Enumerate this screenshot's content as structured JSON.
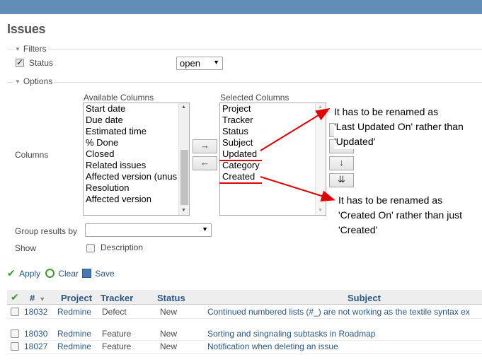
{
  "page": {
    "title": "Issues"
  },
  "filters": {
    "legend": "Filters",
    "status_label": "Status",
    "status_checked": true,
    "status_value": "open"
  },
  "options": {
    "legend": "Options",
    "columns_label": "Columns",
    "available_title": "Available Columns",
    "available_items": [
      "Start date",
      "Due date",
      "Estimated time",
      "% Done",
      "Closed",
      "Related issues",
      "Affected version (unus",
      "Resolution",
      "Affected version"
    ],
    "selected_title": "Selected Columns",
    "selected_items": [
      "Project",
      "Tracker",
      "Status",
      "Subject",
      "Updated",
      "Category",
      "Created"
    ],
    "move_right": "→",
    "move_left": "←",
    "move_top": "⇈",
    "move_up": "↑",
    "move_down": "↓",
    "move_bottom": "⇊",
    "group_label": "Group results by",
    "group_value": "",
    "show_label": "Show",
    "description_label": "Description",
    "description_checked": false
  },
  "actions": {
    "apply": "Apply",
    "clear": "Clear",
    "save": "Save"
  },
  "annotations": {
    "updated_note": [
      "It has to be renamed as",
      "'Last Updated On' rather than",
      "'Updated'"
    ],
    "created_note": [
      "It has to be renamed as",
      "'Created On' rather than just",
      "'Created'"
    ],
    "color": "#e00000"
  },
  "table": {
    "headers": {
      "id": "#",
      "project": "Project",
      "tracker": "Tracker",
      "status": "Status",
      "subject": "Subject"
    },
    "rows": [
      {
        "id": "18032",
        "project": "Redmine",
        "tracker": "Defect",
        "status": "New",
        "subject": "Continued numbered lists (#_) are not working as the textile syntax ex"
      },
      {
        "id": "18030",
        "project": "Redmine",
        "tracker": "Feature",
        "status": "New",
        "subject": "Sorting and singnaling subtasks in Roadmap"
      },
      {
        "id": "18027",
        "project": "Redmine",
        "tracker": "Feature",
        "status": "New",
        "subject": "Notification when deleting an issue"
      }
    ]
  },
  "colors": {
    "topbar": "#628db6",
    "link": "#2a5685"
  }
}
